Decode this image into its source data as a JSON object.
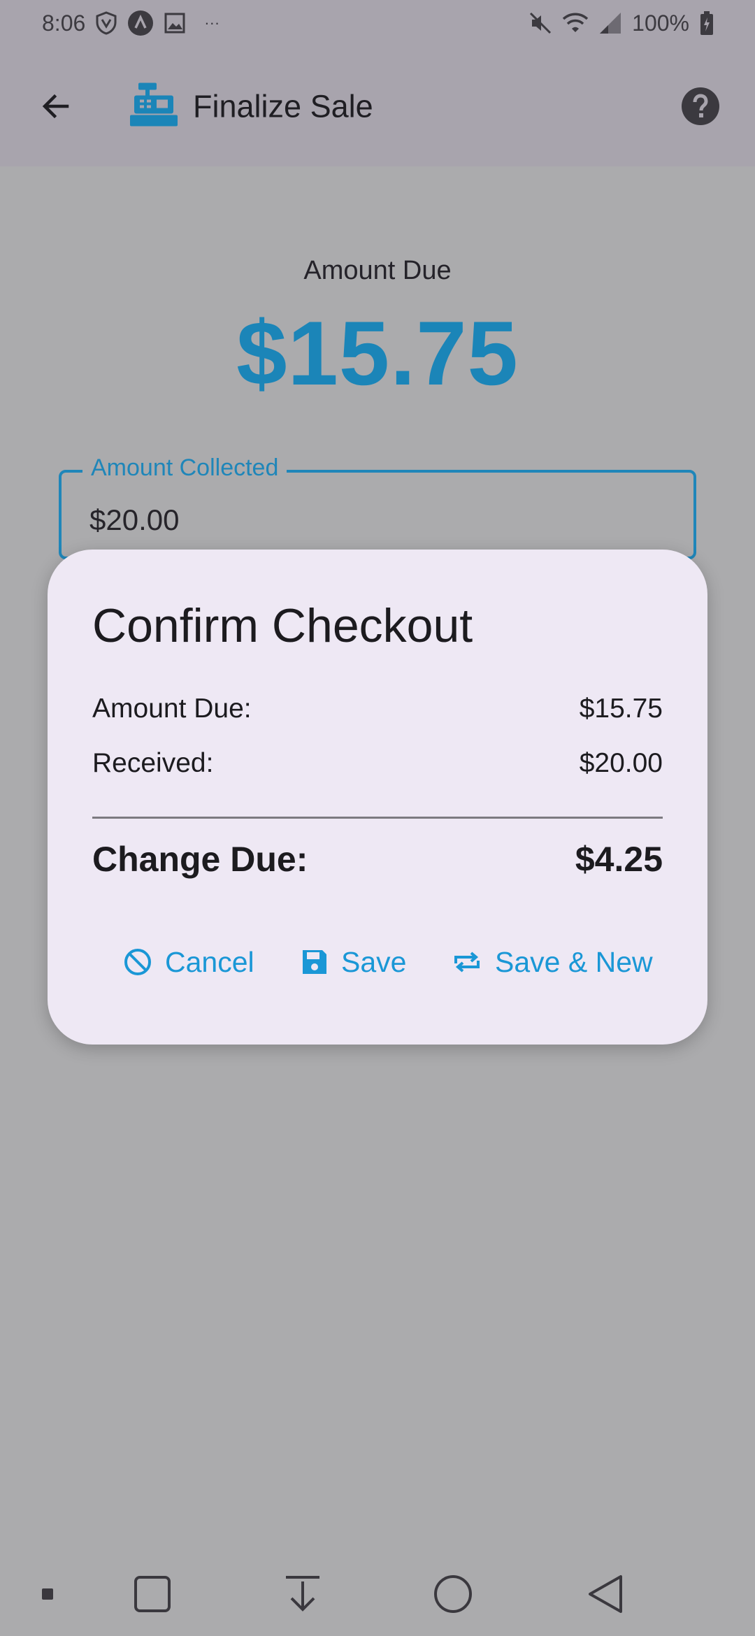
{
  "status_bar": {
    "time": "8:06",
    "battery": "100%",
    "icons_left": [
      "shield-icon",
      "a-badge-icon",
      "image-icon",
      "more-dots-icon"
    ],
    "icons_right": [
      "mute-icon",
      "wifi-icon",
      "signal-icon",
      "battery-charging-icon"
    ],
    "more_dots": "···"
  },
  "app_bar": {
    "title": "Finalize Sale",
    "icon": "cash-register-icon",
    "icon_color": "#1b85b8"
  },
  "main": {
    "amount_due_label": "Amount Due",
    "amount_due_value": "$15.75",
    "amount_collected_label": "Amount Collected",
    "amount_collected_value": "$20.00",
    "accent_color": "#1b85b8"
  },
  "dialog": {
    "title": "Confirm Checkout",
    "amount_due_label": "Amount Due:",
    "amount_due_value": "$15.75",
    "received_label": "Received:",
    "received_value": "$20.00",
    "change_label": "Change Due:",
    "change_value": "$4.25",
    "buttons": {
      "cancel": "Cancel",
      "save": "Save",
      "save_new": "Save & New"
    },
    "button_color": "#1a97d6"
  },
  "nav_bar": {
    "items": [
      "dot-icon",
      "recents-square-icon",
      "download-arrow-icon",
      "home-circle-icon",
      "back-triangle-icon"
    ]
  }
}
